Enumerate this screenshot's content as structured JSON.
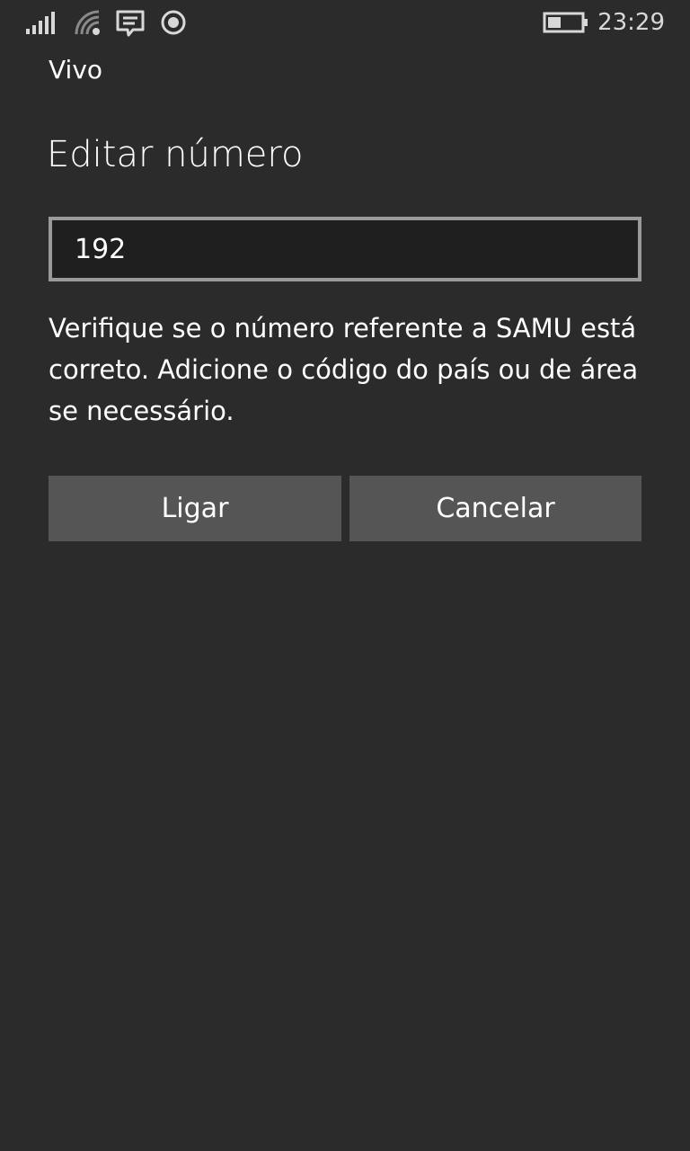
{
  "status_bar": {
    "time": "23:29",
    "icons": {
      "signal": "signal-strength-icon",
      "wifi": "wifi-icon",
      "message": "message-icon",
      "location": "location-icon",
      "battery": "battery-icon"
    },
    "battery_level_fraction": 0.4
  },
  "header": {
    "carrier": "Vivo"
  },
  "dialog": {
    "title": "Editar número",
    "number_value": "192",
    "message": "Verifique se o número referente a SAMU está correto. Adicione o código do país ou de área se necessário.",
    "buttons": {
      "call": "Ligar",
      "cancel": "Cancelar"
    }
  },
  "colors": {
    "background": "#2b2b2b",
    "input_background": "#1f1f1f",
    "input_border": "#9a9a9a",
    "button_background": "#555555",
    "text": "#ffffff"
  }
}
